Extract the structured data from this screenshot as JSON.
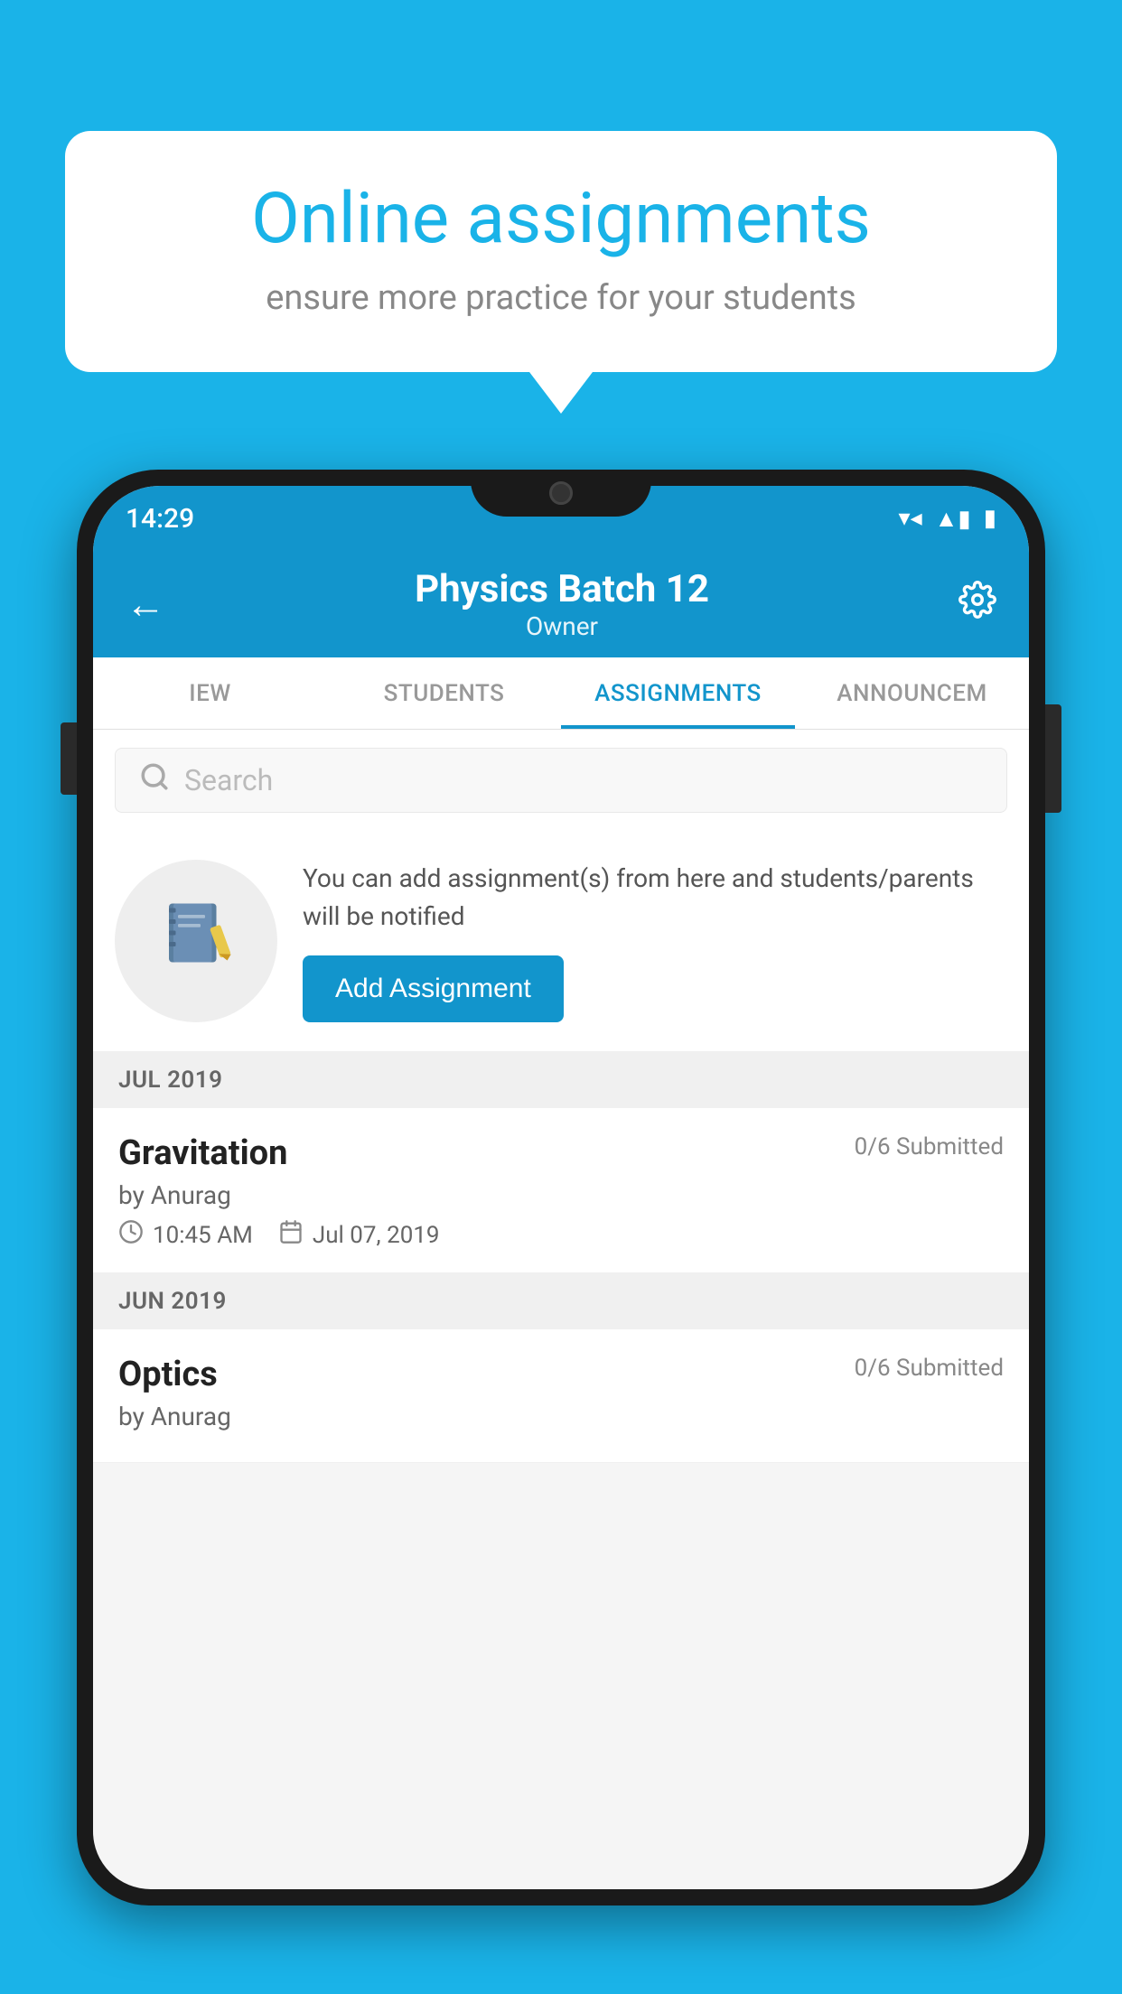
{
  "background": {
    "color": "#1ab3e8"
  },
  "speech_bubble": {
    "title": "Online assignments",
    "subtitle": "ensure more practice for your students"
  },
  "status_bar": {
    "time": "14:29",
    "wifi": "▼▲",
    "battery": "▮"
  },
  "header": {
    "title": "Physics Batch 12",
    "subtitle": "Owner",
    "back_label": "←",
    "settings_label": "⚙"
  },
  "tabs": [
    {
      "label": "IEW",
      "active": false
    },
    {
      "label": "STUDENTS",
      "active": false
    },
    {
      "label": "ASSIGNMENTS",
      "active": true
    },
    {
      "label": "ANNOUNCEM",
      "active": false
    }
  ],
  "search": {
    "placeholder": "Search"
  },
  "promo": {
    "text": "You can add assignment(s) from here and students/parents will be notified",
    "button_label": "Add Assignment"
  },
  "months": [
    {
      "label": "JUL 2019",
      "assignments": [
        {
          "name": "Gravitation",
          "submitted": "0/6 Submitted",
          "by": "by Anurag",
          "time": "10:45 AM",
          "date": "Jul 07, 2019"
        }
      ]
    },
    {
      "label": "JUN 2019",
      "assignments": [
        {
          "name": "Optics",
          "submitted": "0/6 Submitted",
          "by": "by Anurag",
          "time": "",
          "date": ""
        }
      ]
    }
  ]
}
